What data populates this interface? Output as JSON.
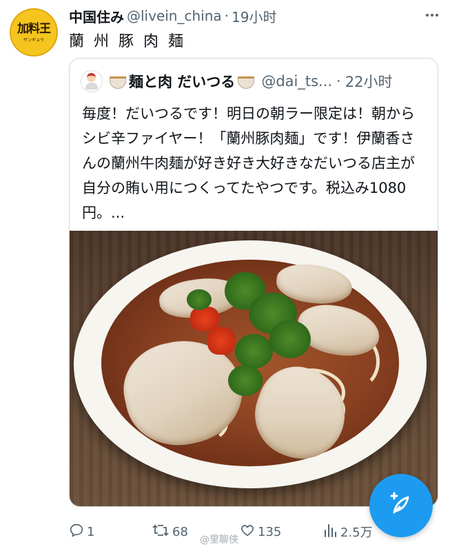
{
  "colors": {
    "accent": "#1d9bf0",
    "text_primary": "#0f1419",
    "text_secondary": "#536471",
    "border": "#cfd9de",
    "avatar_bg": "#f5c41e"
  },
  "tweet": {
    "avatar": {
      "logo_main": "加料王",
      "logo_sub": "ザンギョウ"
    },
    "author_name": "中国住み",
    "author_handle": "@livein_china",
    "separator": "·",
    "time": "19小时",
    "text": "蘭州豚肉麺",
    "more_icon": "more-horizontal-icon"
  },
  "quote": {
    "author_name": "麺と肉 だいつる",
    "author_handle": "@dai_ts...",
    "separator": "·",
    "time": "22小时",
    "text": "毎度！だいつるです！明日の朝ラー限定は！朝からシビ辛ファイヤー！「蘭州豚肉麺」です！伊蘭香さんの蘭州牛肉麺が好き好き大好きなだいつる店主が自分の賄い用につくってたやつです。税込み1080円。...",
    "photo_icon": "noodle-bowl-photo"
  },
  "actions": {
    "reply": {
      "icon": "reply-icon",
      "count": "1"
    },
    "retweet": {
      "icon": "retweet-icon",
      "count": "68"
    },
    "like": {
      "icon": "heart-icon",
      "count": "135"
    },
    "views": {
      "icon": "views-icon",
      "count": "2.5万"
    }
  },
  "compose": {
    "icon": "compose-feather-icon"
  },
  "watermark": "@里聊侠"
}
